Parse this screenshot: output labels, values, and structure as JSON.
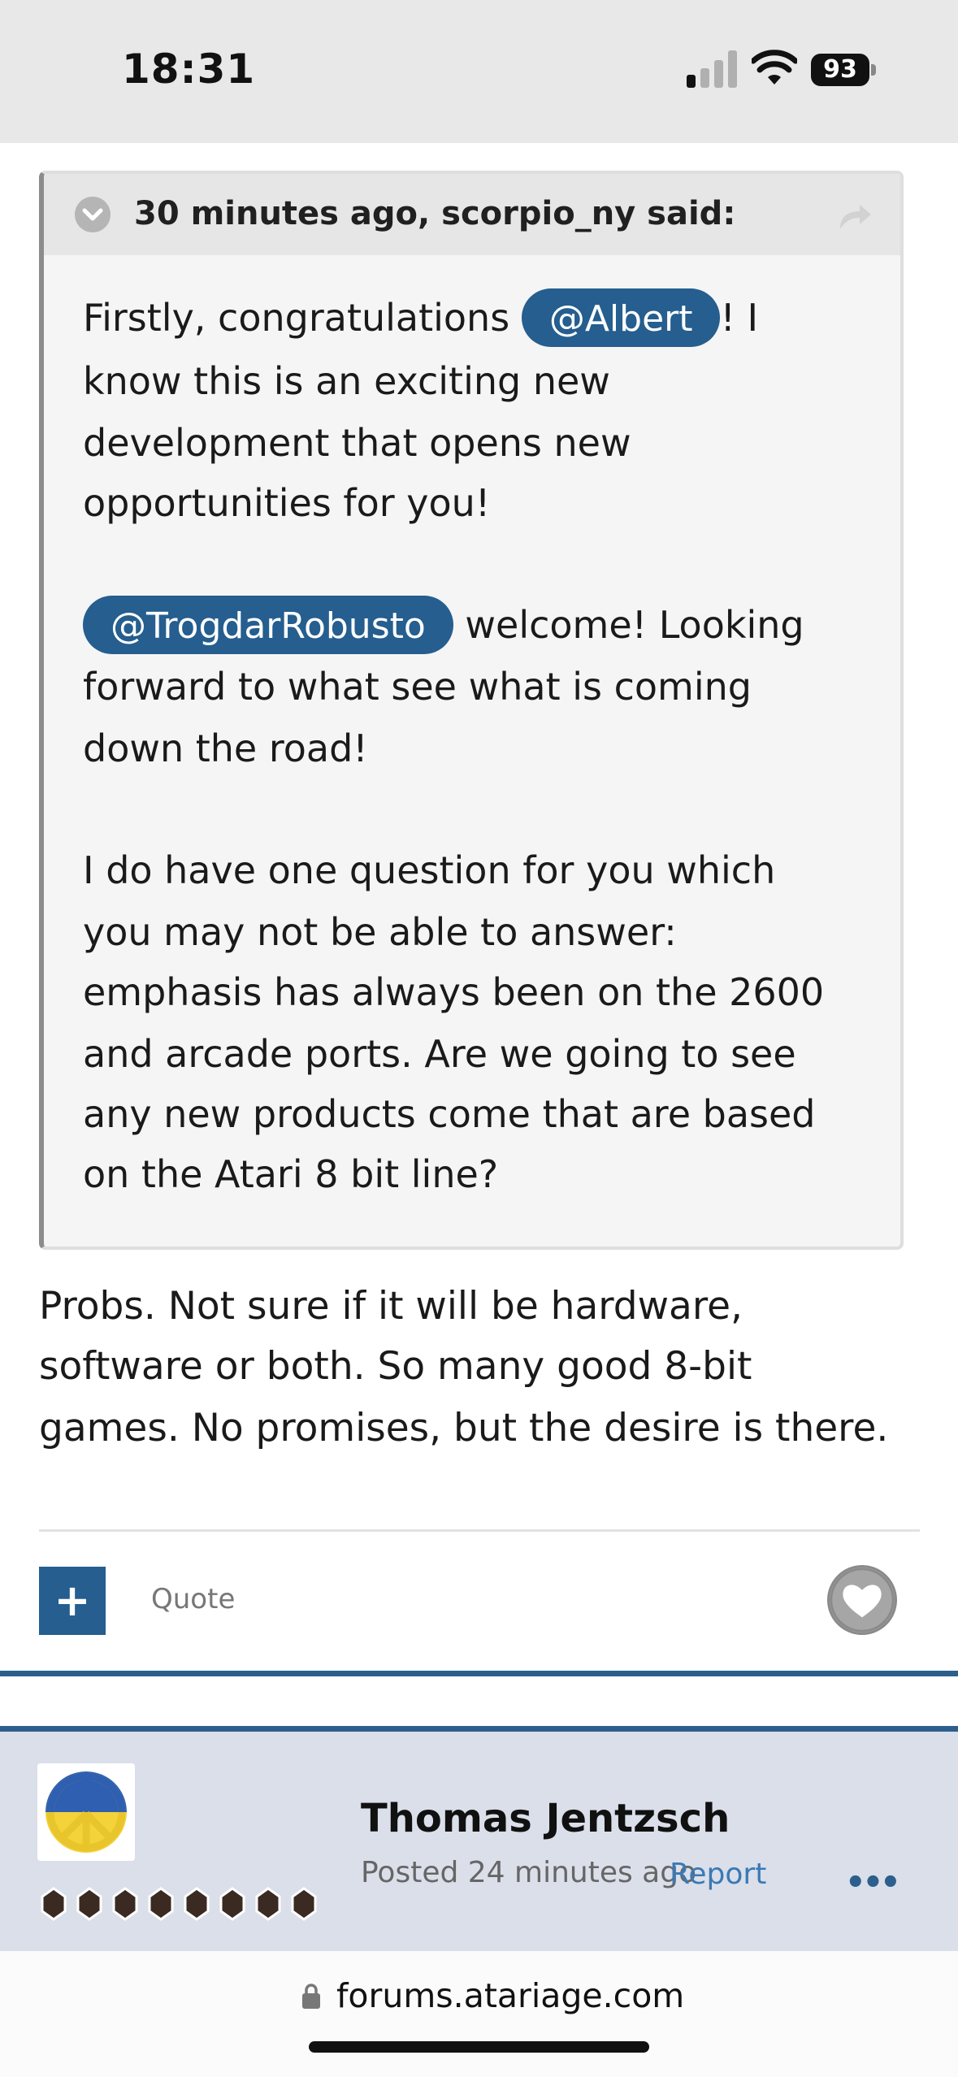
{
  "status_bar": {
    "time": "18:31",
    "battery": "93"
  },
  "quote": {
    "citation": "30 minutes ago, scorpio_ny said:",
    "lines": {
      "l1_before": "Firstly, congratulations ",
      "mention_albert": "@Albert",
      "l1_after": "! I",
      "l2": "know this is an exciting new",
      "l3": "development that opens new",
      "l4": "opportunities for you!",
      "mention_trogdar": "@TrogdarRobusto",
      "l5_after": " welcome! Looking",
      "l6": "forward to what see what is coming",
      "l7": "down the road!",
      "l8": "I do have one question for you which",
      "l9": "you may not be able to answer:",
      "l10": "emphasis has always been on the 2600",
      "l11": "and arcade ports. Are we going to see",
      "l12": "any new products come that are based",
      "l13": "on the Atari 8 bit line?"
    }
  },
  "reply": {
    "l1": "Probs. Not sure if it will be hardware,",
    "l2": "software or both. So many good 8-bit",
    "l3": "games. No promises, but the desire is there."
  },
  "actions": {
    "plus": "+",
    "quote": "Quote"
  },
  "next_post": {
    "author": "Thomas Jentzsch",
    "posted": "Posted 24 minutes ago",
    "report": "Report",
    "more": "•••"
  },
  "browser": {
    "url": "forums.atariage.com"
  },
  "icons": [
    "signal-icon",
    "wifi-icon",
    "battery-icon",
    "chevron-down-icon",
    "share-icon",
    "heart-icon",
    "peace-icon",
    "lock-icon",
    "more-icon"
  ],
  "colors": {
    "accent": "#255e8f",
    "link": "#3b79b4",
    "post_header_bg": "#dadfea"
  }
}
